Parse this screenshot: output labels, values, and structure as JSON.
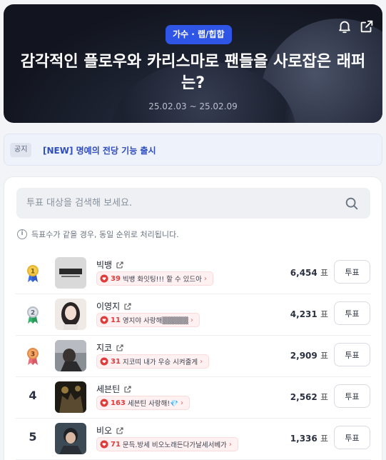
{
  "hero": {
    "category": "가수 · 랩/힙합",
    "title": "감각적인 플로우와 카리스마로 팬들을 사로잡은 래퍼는?",
    "period": "25.02.03 ~ 25.02.09",
    "icons": [
      "bell-icon",
      "share-icon"
    ]
  },
  "notice": {
    "tag": "공지",
    "text": "[NEW] 명예의 전당 기능 출시"
  },
  "search": {
    "placeholder": "투표 대상을 검색해 보세요."
  },
  "info_text": "득표수가 같을 경우, 동일 순위로 처리됩니다.",
  "vote_unit": "표",
  "vote_button_label": "투표",
  "candidates": [
    {
      "rank": "1",
      "medal": "gold",
      "name": "빅뱅",
      "comment_count": "39",
      "comment": "빅뱅 화잇팅!!! 할 수 있드아",
      "votes": "6,454"
    },
    {
      "rank": "2",
      "medal": "silver",
      "name": "이영지",
      "comment_count": "11",
      "comment": "영지야 사랑해▒▒▒▒▒",
      "votes": "4,231"
    },
    {
      "rank": "3",
      "medal": "bronze",
      "name": "지코",
      "comment_count": "31",
      "comment": "지코띠 내가 우승 시켜줄게",
      "votes": "2,909"
    },
    {
      "rank": "4",
      "medal": "",
      "name": "세븐틴",
      "comment_count": "163",
      "comment": "세븐틴 사랑해!💎",
      "votes": "2,562"
    },
    {
      "rank": "5",
      "medal": "",
      "name": "비오",
      "comment_count": "71",
      "comment": "문득.방세 비오노래든다가날세서베가",
      "votes": "1,336"
    }
  ],
  "colors": {
    "accent": "#2f55e6",
    "comment_red": "#e03b3b",
    "gold": "#e8b431",
    "silver": "#b7bcc6",
    "bronze": "#e38a4a"
  }
}
